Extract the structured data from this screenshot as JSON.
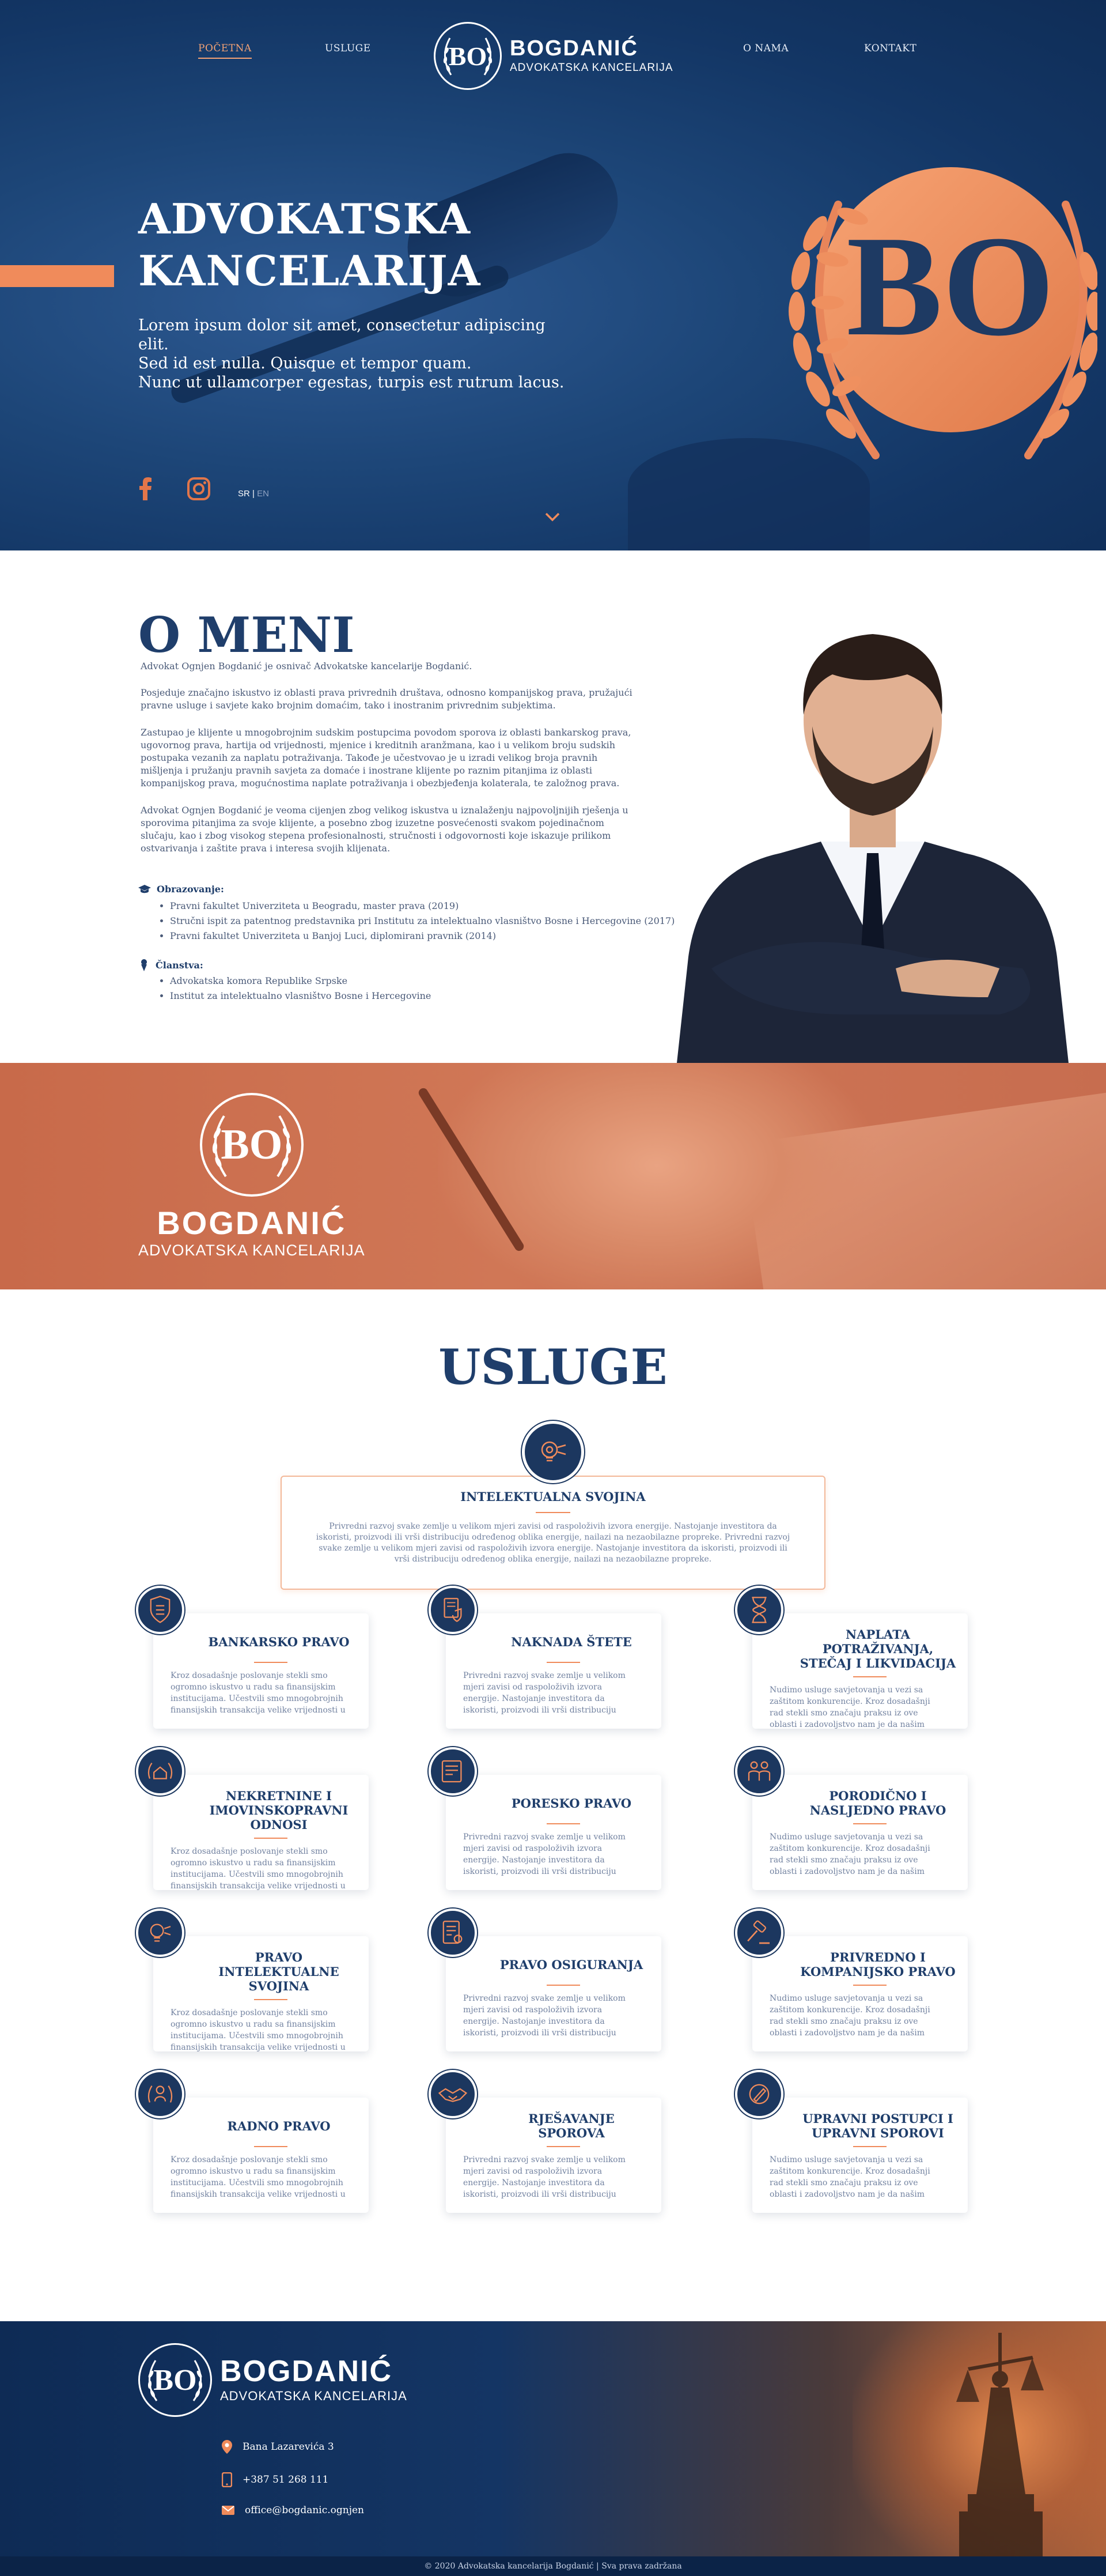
{
  "nav": {
    "items": [
      "POČETNA",
      "USLUGE",
      "O NAMA",
      "KONTAKT"
    ],
    "brand": "BOGDANIĆ",
    "brand_sub": "ADVOKATSKA KANCELARIJA",
    "seal": "BO"
  },
  "hero": {
    "title_line1": "ADVOKATSKA",
    "title_line2": "KANCELARIJA",
    "lead_line1": "Lorem ipsum dolor sit amet, consectetur adipiscing elit.",
    "lead_line2": "Sed id est nulla. Quisque et tempor quam.",
    "lead_line3": "Nunc ut ullamcorper egestas, turpis est rutrum lacus.",
    "lang_active": "SR",
    "lang_sep": "|",
    "lang_other": "EN",
    "emblem": "BO",
    "social_icons": [
      "facebook-icon",
      "instagram-icon"
    ]
  },
  "about": {
    "title": "O MENI",
    "p1": "Advokat Ognjen Bogdanić je osnivač Advokatske kancelarije Bogdanić.",
    "p2": "Posjeduje značajno iskustvo iz oblasti prava privrednih društava, odnosno kompanijskog prava, pružajući pravne usluge i savjete kako brojnim domaćim, tako i inostranim privrednim subjektima.",
    "p3": "Zastupao je klijente u mnogobrojnim sudskim postupcima povodom sporova iz oblasti bankarskog prava, ugovornog prava, hartija od vrijednosti, mjenice i kreditnih aranžmana, kao i u velikom broju sudskih postupaka vezanih za naplatu potraživanja. Takođe je učestvovao je u izradi velikog broja pravnih mišljenja i pružanju pravnih savjeta za domaće i inostrane klijente po raznim pitanjima iz oblasti kompanijskog prava, mogućnostima naplate potraživanja i obezbjeđenja kolaterala, te založnog prava.",
    "p4": "Advokat Ognjen Bogdanić je veoma cijenjen zbog velikog iskustva u iznalaženju najpovoljnijih rješenja u sporovima pitanjima za svoje klijente, a posebno zbog izuzetne posvećenosti svakom pojedinačnom slučaju, kao i zbog visokog stepena profesionalnosti, stručnosti i odgovornosti koje iskazuje prilikom ostvarivanja i zaštite prava i interesa svojih klijenata.",
    "edu_title": "Obrazovanje:",
    "edu": [
      "Pravni fakultet Univerziteta u Beogradu, master prava (2019)",
      "Stručni ispit za patentnog predstavnika pri Institutu za intelektualno vlasništvo Bosne i Hercegovine (2017)",
      "Pravni fakultet Univerziteta u Banjoj Luci, diplomirani pravnik (2014)"
    ],
    "mem_title": "Članstva:",
    "mem": [
      "Advokatska komora Republike Srpske",
      "Institut za intelektualno vlasništvo Bosne i Hercegovine"
    ]
  },
  "banner": {
    "brand": "BOGDANIĆ",
    "brand_sub": "ADVOKATSKA KANCELARIJA",
    "seal": "BO"
  },
  "services": {
    "title": "USLUGE",
    "featured": {
      "title": "INTELEKTUALNA SVOJINA",
      "text": "Privredni razvoj svake zemlje u velikom mjeri zavisi od raspoloživih izvora energije. Nastojanje investitora da iskoristi, proizvodi ili vrši distribuciju određenog oblika energije, nailazi na nezaobilazne propreke. Privredni razvoj svake zemlje u velikom mjeri zavisi od raspoloživih izvora energije. Nastojanje investitora da iskoristi, proizvodi ili vrši distribuciju određenog oblika energije, nailazi na nezaobilazne propreke.",
      "icon": "lightbulb-icon"
    },
    "cards": [
      {
        "title": "BANKARSKO PRAVO",
        "text": "Kroz dosadašnje poslovanje stekli smo ogromno iskustvo u radu sa finansijskim institucijama. Učestvili smo mnogobrojnih finansijskih transakcija velike vrijednosti u",
        "icon": "bank-shield-icon"
      },
      {
        "title": "NAKNADA ŠTETE",
        "text": "Privredni razvoj svake zemlje u velikom mjeri zavisi od raspoloživih izvora energije. Nastojanje investitora da iskoristi, proizvodi ili vrši distribuciju određenog oblika energije,",
        "icon": "document-shield-icon"
      },
      {
        "title": "NAPLATA POTRAŽIVANJA, STEČAJ I LIKVIDACIJA",
        "text": "Nudimo usluge savjetovanja u vezi sa zaštitom konkurencije. Kroz dosadašnji rad stekli smo značaju praksu iz ove oblasti i zadovoljstvo nam je da našim klijentima",
        "icon": "hourglass-icon"
      },
      {
        "title": "NEKRETNINE I IMOVINSKOPRAVNI ODNOSI",
        "text": "Kroz dosadašnje poslovanje stekli smo ogromno iskustvo u radu sa finansijskim institucijama. Učestvili smo mnogobrojnih finansijskih transakcija velike vrijednosti u",
        "icon": "house-laurel-icon"
      },
      {
        "title": "PORESKO PRAVO",
        "text": "Privredni razvoj svake zemlje u velikom mjeri zavisi od raspoloživih izvora energije. Nastojanje investitora da iskoristi, proizvodi ili vrši distribuciju određenog oblika energije,",
        "icon": "tax-document-icon"
      },
      {
        "title": "PORODIČNO I NASLJEDNO PRAVO",
        "text": "Nudimo usluge savjetovanja u vezi sa zaštitom konkurencije. Kroz dosadašnji rad stekli smo značaju praksu iz ove oblasti i zadovoljstvo nam je da našim klijentima",
        "icon": "family-icon"
      },
      {
        "title": "PRAVO INTELEKTUALNE SVOJINA",
        "text": "Kroz dosadašnje poslovanje stekli smo ogromno iskustvo u radu sa finansijskim institucijama. Učestvili smo mnogobrojnih finansijskih transakcija velike vrijednosti u",
        "icon": "lightbulb-icon"
      },
      {
        "title": "PRAVO OSIGURANJA",
        "text": "Privredni razvoj svake zemlje u velikom mjeri zavisi od raspoloživih izvora energije. Nastojanje investitora da iskoristi, proizvodi ili vrši distribuciju određenog oblika energije,",
        "icon": "insurance-document-icon"
      },
      {
        "title": "PRIVREDNO I KOMPANIJSKO PRAVO",
        "text": "Nudimo usluge savjetovanja u vezi sa zaštitom konkurencije. Kroz dosadašnji rad stekli smo značaju praksu iz ove oblasti i zadovoljstvo nam je da našim klijentima",
        "icon": "gavel-icon"
      },
      {
        "title": "RADNO PRAVO",
        "text": "Kroz dosadašnje poslovanje stekli smo ogromno iskustvo u radu sa finansijskim institucijama. Učestvili smo mnogobrojnih finansijskih transakcija velike vrijednosti u",
        "icon": "worker-laurel-icon"
      },
      {
        "title": "RJEŠAVANJE SPOROVA",
        "text": "Privredni razvoj svake zemlje u velikom mjeri zavisi od raspoloživih izvora energije. Nastojanje investitora da iskoristi, proizvodi ili vrši distribuciju određenog oblika energije,",
        "icon": "handshake-icon"
      },
      {
        "title": "UPRAVNI POSTUPCI I UPRAVNI SPOROVI",
        "text": "Nudimo usluge savjetovanja u vezi sa zaštitom konkurencije. Kroz dosadašnji rad stekli smo značaju praksu iz ove oblasti i zadovoljstvo nam je da našim klijentima",
        "icon": "pen-icon"
      }
    ]
  },
  "footer": {
    "brand": "BOGDANIĆ",
    "brand_sub": "ADVOKATSKA KANCELARIJA",
    "seal": "BO",
    "address": "Bana Lazarevića 3",
    "phone": "+387 51 268 111",
    "email": "office@bogdanic.ognjen",
    "copyright": "© 2020 Advokatska kancelarija Bogdanić | Sva prava zadržana"
  },
  "colors": {
    "navy": "#1f3e6b",
    "accent": "#f08b5b",
    "hero_bg": "#163c6a",
    "banner_bg": "#c86a4a"
  }
}
